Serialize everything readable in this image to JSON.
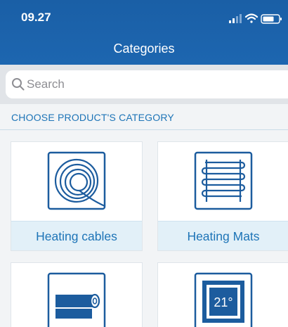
{
  "status_bar": {
    "time": "09.27"
  },
  "nav": {
    "title": "Categories"
  },
  "search": {
    "placeholder": "Search"
  },
  "section": {
    "label": "CHOOSE PRODUCT'S CATEGORY"
  },
  "categories": [
    {
      "label": "Heating cables",
      "icon": "cable-coil-icon"
    },
    {
      "label": "Heating Mats",
      "icon": "heating-mat-icon"
    },
    {
      "label": "",
      "icon": "foil-roll-icon"
    },
    {
      "label": "",
      "icon": "thermostat-icon"
    }
  ],
  "colors": {
    "header": "#1d66b0",
    "accent": "#1d74b7",
    "label_bg": "#e2f0f8"
  }
}
